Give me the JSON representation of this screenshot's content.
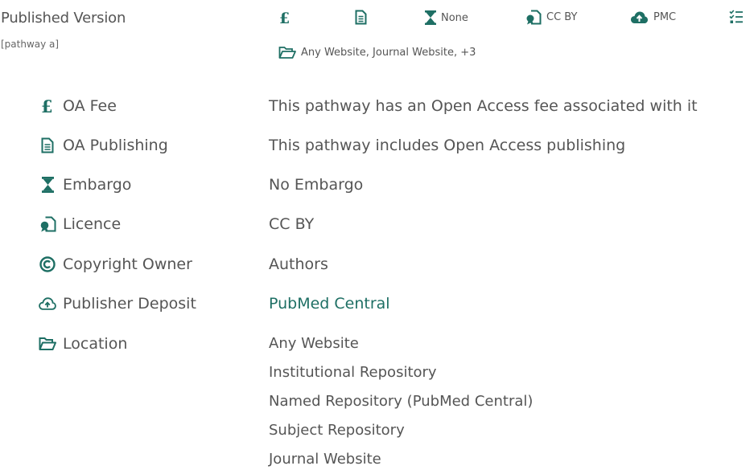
{
  "header": {
    "title": "Published Version",
    "subtitle": "[pathway a]",
    "embargo_short": "None",
    "licence_short": "CC BY",
    "deposit_short": "PMC",
    "locations_short": "Any Website, Journal Website, +3"
  },
  "rows": {
    "oa_fee": {
      "label": "OA Fee",
      "value": "This pathway has an Open Access fee associated with it"
    },
    "oa_publishing": {
      "label": "OA Publishing",
      "value": "This pathway includes Open Access publishing"
    },
    "embargo": {
      "label": "Embargo",
      "value": "No Embargo"
    },
    "licence": {
      "label": "Licence",
      "value": "CC BY"
    },
    "copyright": {
      "label": "Copyright Owner",
      "value": "Authors"
    },
    "deposit": {
      "label": "Publisher Deposit",
      "value": "PubMed Central"
    },
    "location": {
      "label": "Location",
      "values": [
        "Any Website",
        "Institutional Repository",
        "Named Repository (PubMed Central)",
        "Subject Repository",
        "Journal Website"
      ]
    }
  },
  "icons": {
    "fee": "pound-icon",
    "publishing": "document-icon",
    "embargo": "hourglass-icon",
    "licence": "licence-icon",
    "copyright": "copyright-icon",
    "deposit": "cloud-upload-icon",
    "location": "folder-open-icon",
    "conditions": "checklist-icon"
  },
  "colors": {
    "accent": "#1e6f64",
    "text": "#555555"
  }
}
